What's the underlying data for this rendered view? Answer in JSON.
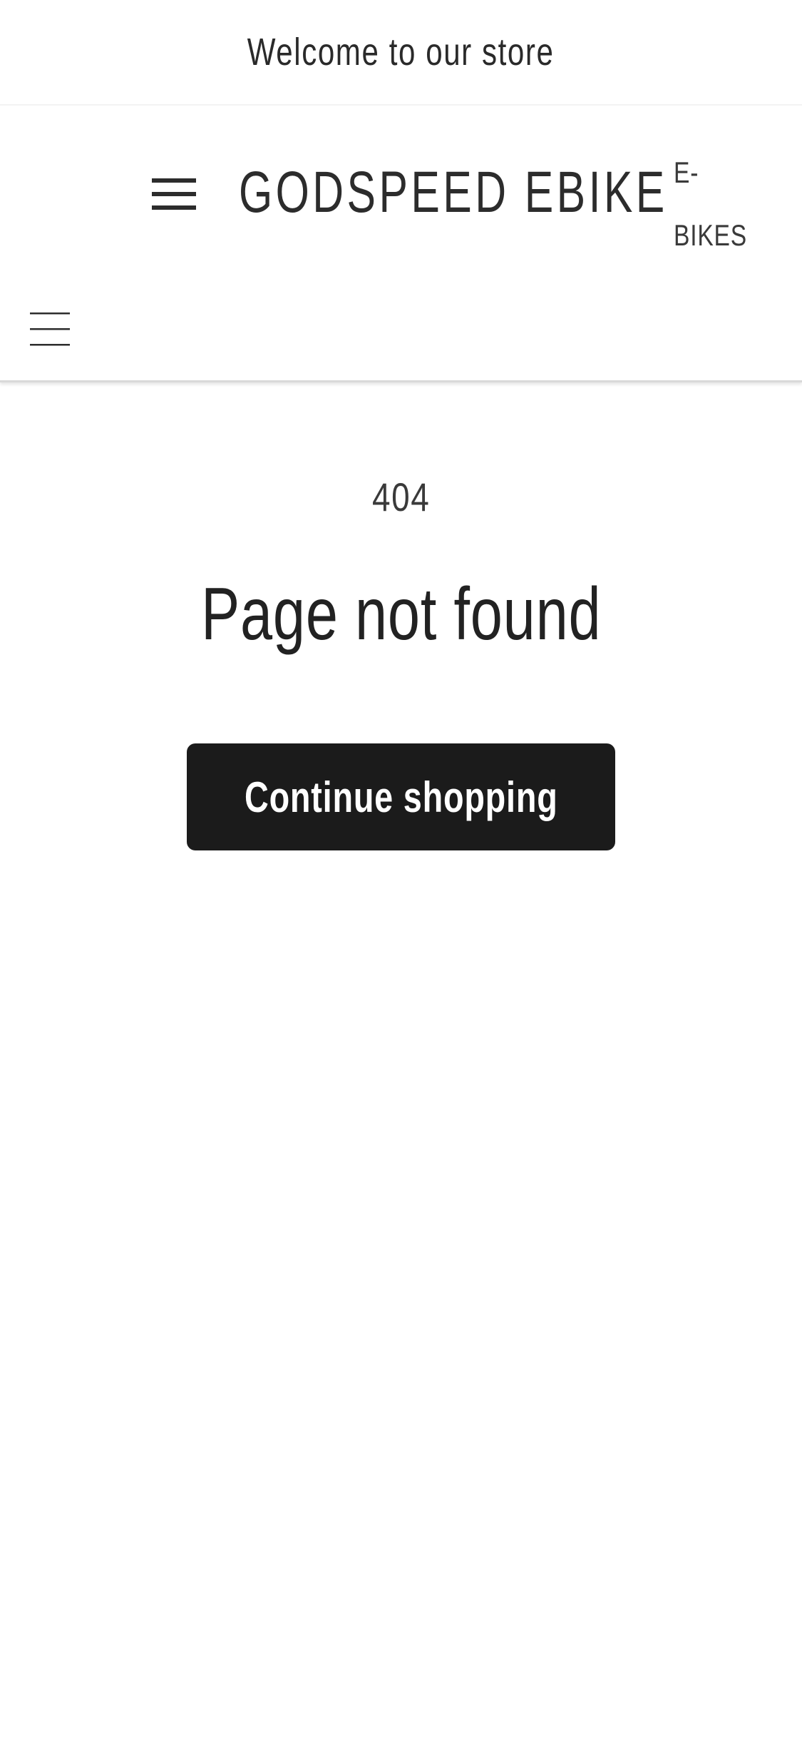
{
  "announcement": {
    "text": "Welcome to our store"
  },
  "header": {
    "brand": "GODSPEED EBIKE",
    "nav_link_line1": "E-",
    "nav_link_line2": "BIKES",
    "menu_icon": "hamburger-menu-icon"
  },
  "main": {
    "error_code": "404",
    "title": "Page not found",
    "cta_label": "Continue shopping"
  },
  "colors": {
    "background": "#ffffff",
    "text": "#222222",
    "button_bg": "#1b1b1b",
    "button_text": "#ffffff"
  }
}
